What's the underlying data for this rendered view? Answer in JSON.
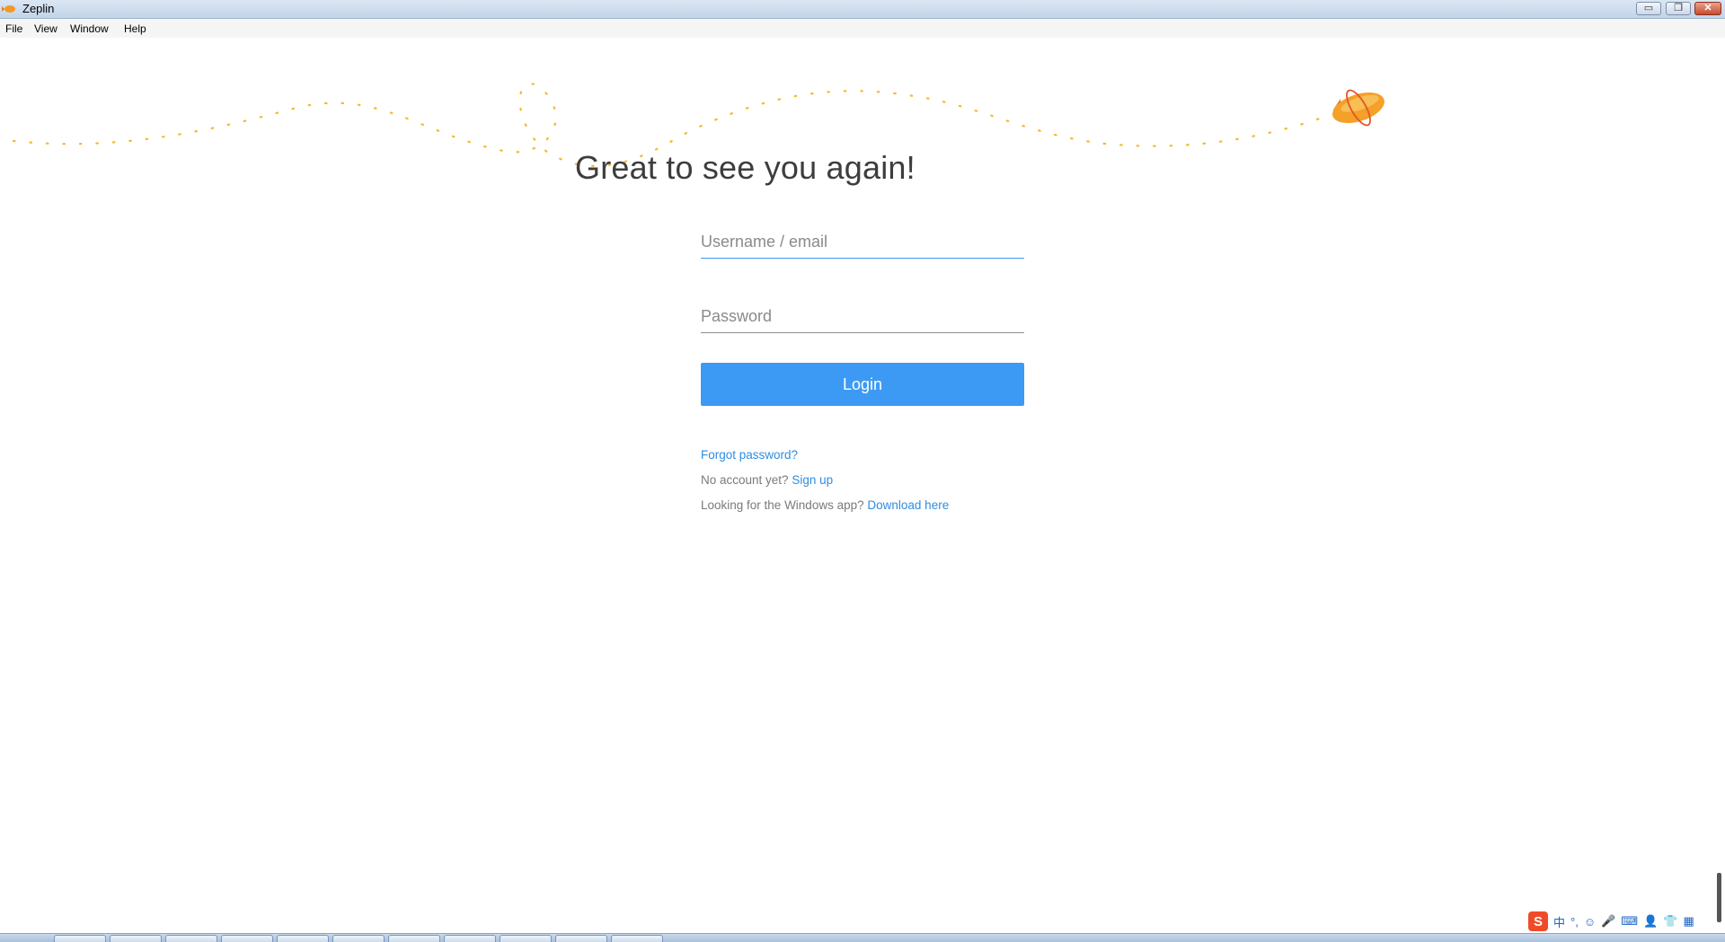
{
  "window": {
    "title": "Zeplin",
    "controls": {
      "minimize": "▭",
      "restore": "❐",
      "close": "✕"
    }
  },
  "menu": {
    "items": [
      "File",
      "View",
      "Window",
      "Help"
    ]
  },
  "login": {
    "heading": "Great to see you again!",
    "username_placeholder": "Username / email",
    "username_value": "",
    "password_placeholder": "Password",
    "password_value": "",
    "login_label": "Login",
    "forgot_label": "Forgot password?",
    "no_account_text": "No account yet?",
    "signup_label": "Sign up",
    "windows_app_text": "Looking for the Windows app?",
    "download_label": "Download here"
  },
  "ime": {
    "logo": "S",
    "mode": "中",
    "punct": "°,",
    "icons": [
      "☺",
      "🎤",
      "⌨",
      "👤",
      "👕",
      "▦"
    ]
  },
  "colors": {
    "accent": "#3d9af4",
    "link": "#2e8de0",
    "heading": "#3d3d3d",
    "dotted_path": "#f5b82e",
    "zeppelin": "#f39a26"
  }
}
